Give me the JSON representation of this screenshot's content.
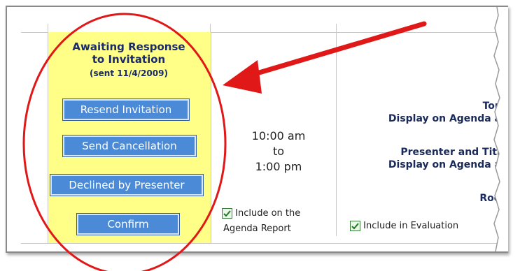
{
  "status": {
    "title_line1": "Awaiting Response",
    "title_line2": "to Invitation",
    "sent_note": "(sent 11/4/2009)"
  },
  "buttons": {
    "resend": "Resend Invitation",
    "cancel": "Send Cancellation",
    "declined": "Declined by Presenter",
    "confirm": "Confirm"
  },
  "session": {
    "start_time": "10:00 am",
    "to": "to",
    "end_time": "1:00 pm",
    "include_agenda_line1": "Include on the",
    "include_agenda_line2": "Agenda Report",
    "include_agenda_checked": true
  },
  "details": {
    "topic_label": "Topic",
    "display_agenda_label_1": "Display on Agenda as:",
    "presenter_label": "Presenter and Title:",
    "display_agenda_label_2": "Display on Agenda as:",
    "room_label": "Room",
    "include_eval": "Include in Evaluation",
    "include_eval_checked": true
  },
  "colors": {
    "highlight_cell": "#ffff88",
    "button_bg": "#4b8ad6",
    "annotation_red": "#e01818"
  },
  "icons": {
    "checkbox": "checkbox-checked-icon",
    "annotation_arrow": "red-arrow-icon",
    "annotation_circle": "red-ellipse-icon"
  }
}
